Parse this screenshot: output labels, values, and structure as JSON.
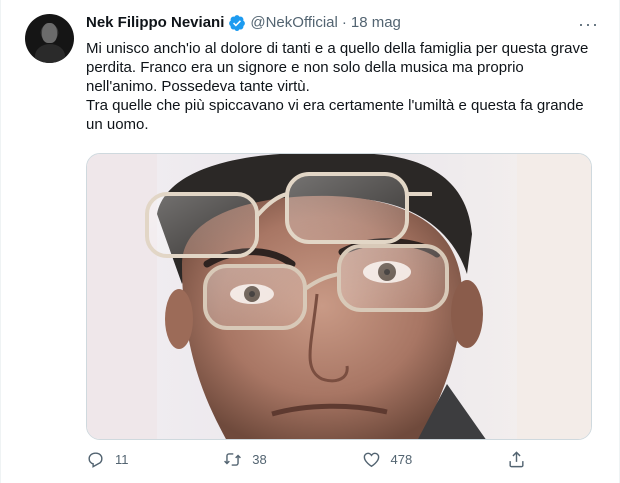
{
  "author": {
    "name": "Nek Filippo Neviani",
    "handle": "@NekOfficial",
    "separator": "·",
    "date": "18 mag",
    "verified": true
  },
  "tweet": {
    "paragraph_1": "Mi unisco anch'io al dolore di tanti e a quello della famiglia per questa grave perdita. Franco era un signore e non solo della musica ma proprio nell'animo. Possedeva tante virtù.",
    "paragraph_2": "Tra quelle che più spiccavano vi era certamente l'umiltà e questa fa grande un uomo."
  },
  "more_menu": "···",
  "actions": {
    "reply": {
      "icon": "reply-icon",
      "count": "11"
    },
    "retweet": {
      "icon": "retweet-icon",
      "count": "38"
    },
    "like": {
      "icon": "heart-icon",
      "count": "478"
    },
    "share": {
      "icon": "share-icon"
    }
  },
  "colors": {
    "verified": "#1d9bf0",
    "secondary_text": "#536471",
    "primary_text": "#0f1419"
  }
}
